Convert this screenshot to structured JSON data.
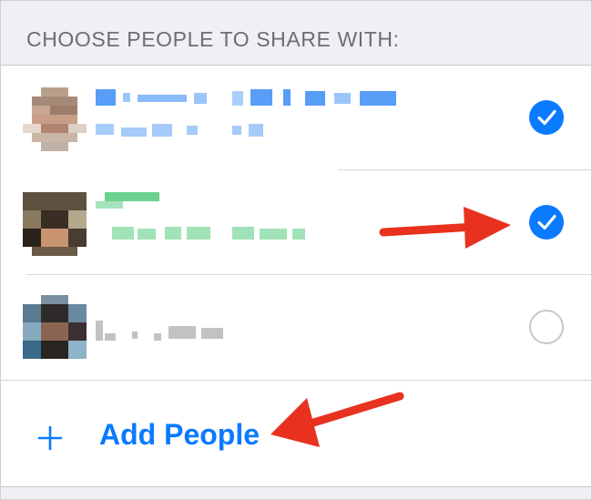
{
  "section_header": "CHOOSE PEOPLE TO SHARE WITH:",
  "contacts": [
    {
      "name_blurred": true,
      "selected": true,
      "name_color": "#3b8cf5"
    },
    {
      "name_blurred": true,
      "selected": true,
      "name_color": "#48c774"
    },
    {
      "name_blurred": true,
      "selected": false,
      "name_color": "#9a9a9a"
    }
  ],
  "add_row": {
    "icon": "plus-icon",
    "label": "Add People"
  },
  "colors": {
    "accent": "#0a7aff",
    "annotation_arrow": "#e8321f",
    "background": "#efeff4"
  },
  "annotations": [
    {
      "type": "arrow",
      "points_to": "contact-2-checkmark"
    },
    {
      "type": "arrow",
      "points_to": "add-people-button"
    }
  ]
}
